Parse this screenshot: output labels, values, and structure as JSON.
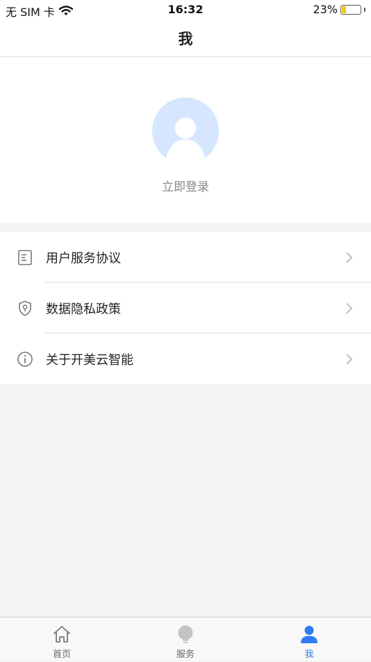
{
  "status_bar": {
    "carrier": "无 SIM 卡",
    "time": "16:32",
    "battery_percent_text": "23%",
    "battery_level": 0.23,
    "battery_color": "#f0c419"
  },
  "nav": {
    "title": "我"
  },
  "profile": {
    "avatar_icon": "default-avatar-icon",
    "avatar_color": "#d6e6ff",
    "login_label": "立即登录"
  },
  "menu": {
    "items": [
      {
        "label": "用户服务协议",
        "icon": "document-icon"
      },
      {
        "label": "数据隐私政策",
        "icon": "shield-icon"
      },
      {
        "label": "关于开美云智能",
        "icon": "info-icon"
      }
    ]
  },
  "tabbar": {
    "accent_color": "#2f7bf5",
    "tabs": [
      {
        "label": "首页",
        "icon": "home-icon",
        "active": false
      },
      {
        "label": "服务",
        "icon": "lightbulb-icon",
        "active": false
      },
      {
        "label": "我",
        "icon": "person-icon",
        "active": true
      }
    ]
  }
}
